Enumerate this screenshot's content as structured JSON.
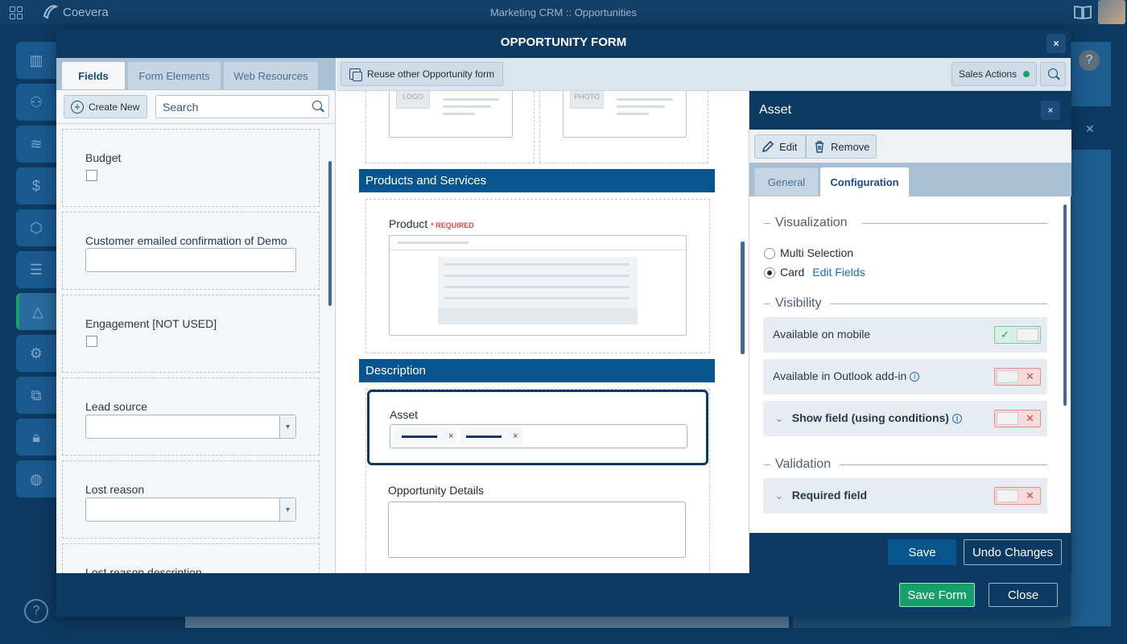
{
  "topbar": {
    "brand": "Coevera",
    "app_title": "Marketing CRM :: Opportunities"
  },
  "modal": {
    "title": "OPPORTUNITY FORM",
    "close_label": "×"
  },
  "left_panel": {
    "tabs": [
      "Fields",
      "Form Elements",
      "Web Resources"
    ],
    "create_label": "Create New",
    "search_value": "Search",
    "fields": [
      {
        "label": "Budget",
        "type": "checkbox"
      },
      {
        "label": "Customer emailed confirmation of Demo",
        "type": "text"
      },
      {
        "label": "Engagement [NOT USED]",
        "type": "checkbox"
      },
      {
        "label": "Lead source",
        "type": "select"
      },
      {
        "label": "Lost reason",
        "type": "select"
      },
      {
        "label": "Lost reason description",
        "type": "text"
      }
    ]
  },
  "toolbar": {
    "reuse_label": "Reuse other Opportunity form",
    "sales_actions_label": "Sales Actions"
  },
  "canvas": {
    "logo_placeholder": "LOGO",
    "photo_placeholder": "PHOTO",
    "section_products": "Products and Services",
    "product_label": "Product",
    "required_tag": "* REQUIRED",
    "section_description": "Description",
    "asset_label": "Asset",
    "asset_chip_remove": "×",
    "opportunity_details_label": "Opportunity Details"
  },
  "right_panel": {
    "title": "Asset",
    "close_label": "×",
    "edit_label": "Edit",
    "remove_label": "Remove",
    "tabs": [
      "General",
      "Configuration"
    ],
    "visualization_heading": "Visualization",
    "option_multi": "Multi Selection",
    "option_card": "Card",
    "edit_fields_link": "Edit Fields",
    "visibility_heading": "Visibility",
    "available_mobile": "Available on mobile",
    "available_outlook": "Available in Outlook add-in",
    "show_field": "Show field (using conditions)",
    "validation_heading": "Validation",
    "required_field": "Required field",
    "save_label": "Save",
    "undo_label": "Undo Changes"
  },
  "footer": {
    "save_form_label": "Save Form",
    "close_label": "Close"
  },
  "colors": {
    "navy": "#0d3a62",
    "section_blue": "#06558f",
    "accent_green": "#18a06c",
    "link_blue": "#1a6fb3"
  }
}
